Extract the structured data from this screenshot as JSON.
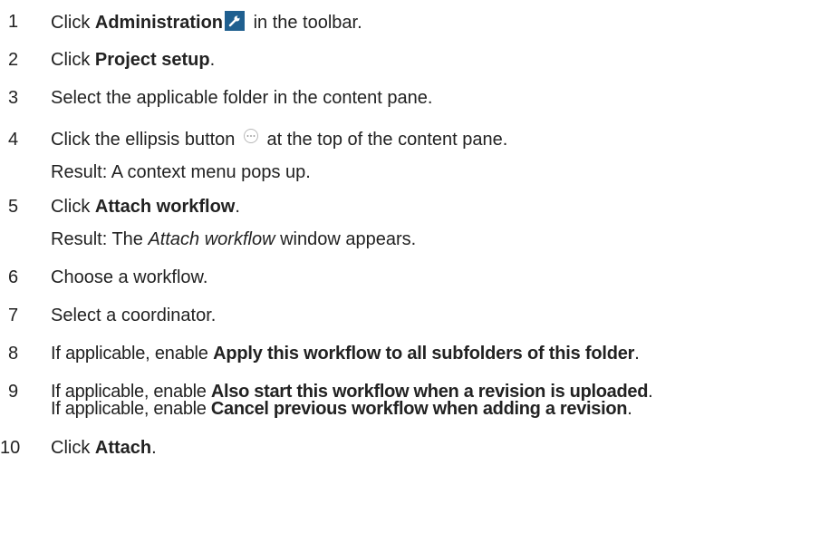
{
  "steps": [
    {
      "num": "1",
      "pre": "Click ",
      "bold": "Administration",
      "post": " in the toolbar.",
      "icon": "wrench-icon"
    },
    {
      "num": "2",
      "pre": "Click ",
      "bold": "Project setup",
      "post": "."
    },
    {
      "num": "3",
      "text": "Select the applicable folder in the content pane."
    },
    {
      "num": "4",
      "pre": "Click the ellipsis button ",
      "post": " at the top of the content pane.",
      "icon": "ellipsis-icon",
      "result": "Result: A context menu pops up."
    },
    {
      "num": "5",
      "pre": "Click ",
      "bold": "Attach workflow",
      "post": ".",
      "result_pre": "Result: The ",
      "result_italic": "Attach workflow",
      "result_post": " window appears."
    },
    {
      "num": "6",
      "text": "Choose a workflow."
    },
    {
      "num": "7",
      "text": "Select a coordinator."
    },
    {
      "num": "8",
      "pre": "If applicable, enable ",
      "bold": "Apply this workflow to all subfolders of this folder",
      "post": "."
    },
    {
      "num": "9",
      "pre": "If applicable, enable ",
      "bold": "Also start this workflow when a revision is uploaded",
      "post": ".",
      "line2_pre": "If applicable, enable ",
      "line2_bold": "Cancel previous workflow when adding a revision",
      "line2_post": "."
    },
    {
      "num": "10",
      "pre": "Click ",
      "bold": "Attach",
      "post": "."
    }
  ],
  "icon_colors": {
    "wrench_bg": "#1f5f8f",
    "ellipsis_border": "#b9b9b9"
  }
}
